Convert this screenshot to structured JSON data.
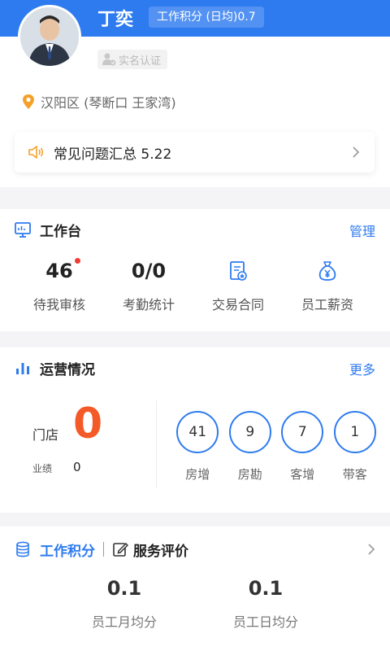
{
  "profile": {
    "name": "丁奕",
    "score_pill": "工作积分 (日均)0.7",
    "verify_label": "实名认证",
    "location": "汉阳区 (琴断口 王家湾)"
  },
  "faq": {
    "text": "常见问题汇总 5.22"
  },
  "workbench": {
    "title": "工作台",
    "manage_label": "管理",
    "items": [
      {
        "value": "46",
        "label": "待我审核",
        "badge": true
      },
      {
        "value": "0/0",
        "label": "考勤统计"
      },
      {
        "icon": "contract-icon",
        "label": "交易合同"
      },
      {
        "icon": "salary-icon",
        "label": "员工薪资"
      }
    ]
  },
  "operations": {
    "title": "运营情况",
    "more_label": "更多",
    "store_label": "门店",
    "store_value": "0",
    "perf_label": "业绩",
    "perf_value": "0",
    "stats": [
      {
        "value": "41",
        "label": "房增"
      },
      {
        "value": "9",
        "label": "房勘"
      },
      {
        "value": "7",
        "label": "客增"
      },
      {
        "value": "1",
        "label": "带客"
      }
    ]
  },
  "scores": {
    "tab_active": "工作积分",
    "tab_inactive": "服务评价",
    "items": [
      {
        "value": "0.1",
        "label": "员工月均分"
      },
      {
        "value": "0.1",
        "label": "员工日均分"
      }
    ]
  },
  "colors": {
    "brand_blue": "#2e7bf0",
    "accent_orange": "#f45a27",
    "badge_red": "#f03b32"
  }
}
